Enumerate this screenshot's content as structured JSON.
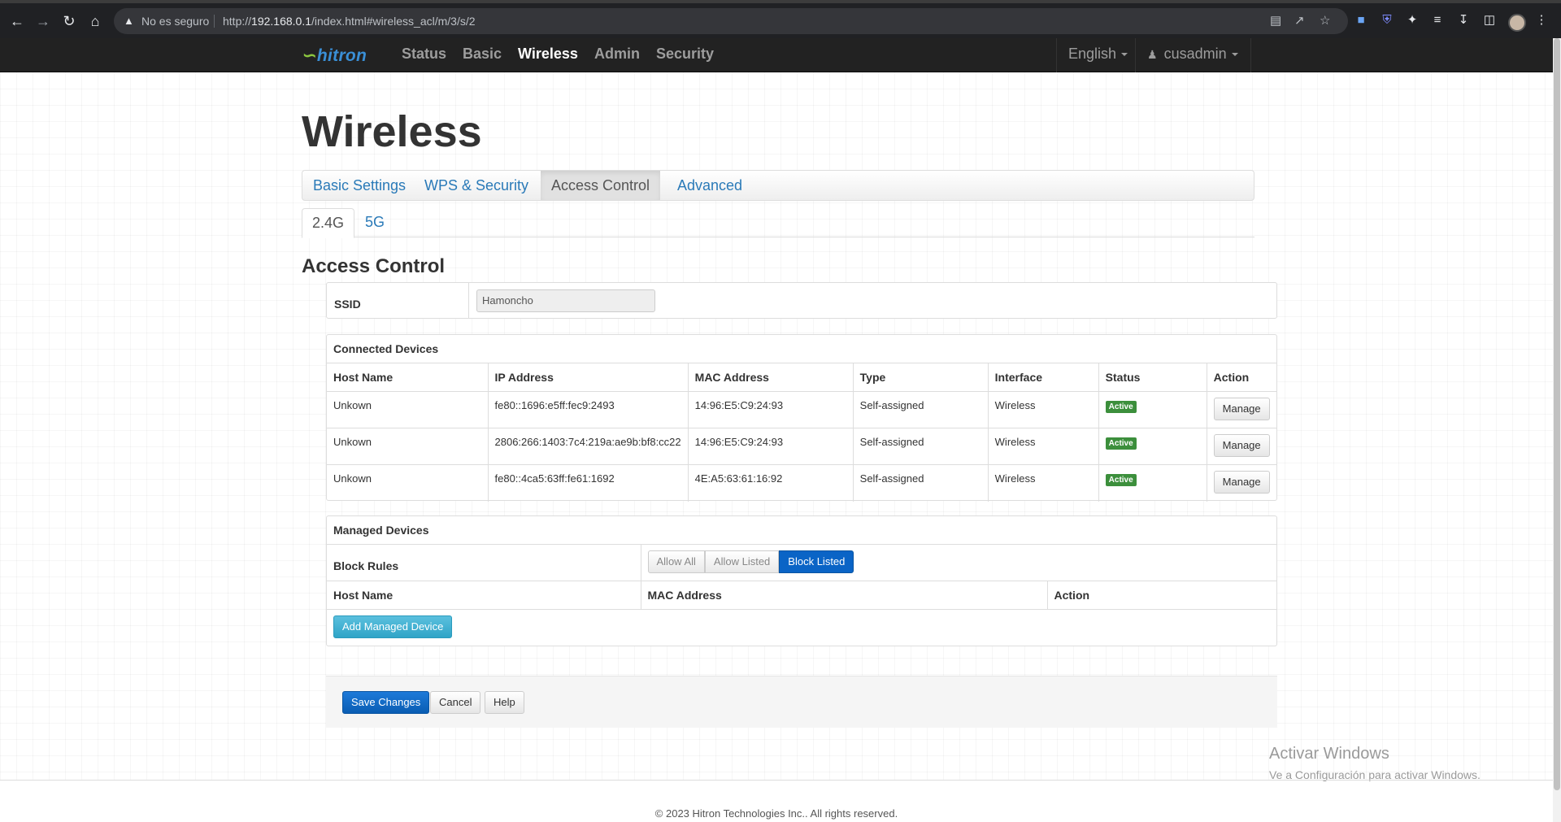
{
  "browser": {
    "security_text": "No es seguro",
    "url_prefix": "http://",
    "url_host": "192.168.0.1",
    "url_path": "/index.html#wireless_acl/m/3/s/2",
    "icons": [
      "back-icon",
      "forward-icon",
      "reload-icon",
      "home-icon",
      "warning-icon",
      "translate-icon",
      "share-icon",
      "star-icon",
      "extension-icon",
      "shield-icon",
      "puzzle-icon",
      "queue-icon",
      "download-icon",
      "sidebar-icon",
      "avatar",
      "menu-icon"
    ]
  },
  "topnav": {
    "logo": "hitron",
    "items": [
      {
        "label": "Status"
      },
      {
        "label": "Basic"
      },
      {
        "label": "Wireless",
        "active": true
      },
      {
        "label": "Admin"
      },
      {
        "label": "Security"
      }
    ],
    "language": "English",
    "user": "cusadmin"
  },
  "page": {
    "title": "Wireless",
    "tabs": [
      {
        "label": "Basic Settings"
      },
      {
        "label": "WPS & Security"
      },
      {
        "label": "Access Control",
        "active": true
      },
      {
        "label": "Advanced"
      }
    ],
    "band_tabs": [
      {
        "label": "2.4G",
        "active": true
      },
      {
        "label": "5G"
      }
    ],
    "section_title": "Access Control"
  },
  "ssid": {
    "label": "SSID",
    "value": "Hamoncho"
  },
  "connected": {
    "title": "Connected Devices",
    "columns": [
      "Host Name",
      "IP Address",
      "MAC Address",
      "Type",
      "Interface",
      "Status",
      "Action"
    ],
    "rows": [
      {
        "host": "Unkown",
        "ip": "fe80::1696:e5ff:fec9:2493",
        "mac": "14:96:E5:C9:24:93",
        "type": "Self-assigned",
        "interface": "Wireless",
        "status": "Active",
        "action": "Manage"
      },
      {
        "host": "Unkown",
        "ip": "2806:266:1403:7c4:219a:ae9b:bf8:cc22",
        "mac": "14:96:E5:C9:24:93",
        "type": "Self-assigned",
        "interface": "Wireless",
        "status": "Active",
        "action": "Manage"
      },
      {
        "host": "Unkown",
        "ip": "fe80::4ca5:63ff:fe61:1692",
        "mac": "4E:A5:63:61:16:92",
        "type": "Self-assigned",
        "interface": "Wireless",
        "status": "Active",
        "action": "Manage"
      }
    ]
  },
  "managed": {
    "title": "Managed Devices",
    "block_rules_label": "Block Rules",
    "block_options": [
      {
        "label": "Allow All"
      },
      {
        "label": "Allow Listed"
      },
      {
        "label": "Block Listed",
        "selected": true
      }
    ],
    "columns": [
      "Host Name",
      "MAC Address",
      "Action"
    ],
    "add_button": "Add Managed Device"
  },
  "actions": {
    "save": "Save Changes",
    "cancel": "Cancel",
    "help": "Help"
  },
  "watermark": {
    "line1": "Activar Windows",
    "line2": "Ve a Configuración para activar Windows."
  },
  "footer": "© 2023 Hitron Technologies Inc.. All rights reserved.",
  "colors": {
    "nav_bg": "#222222",
    "link": "#2a7ab8",
    "primary": "#0a64c6",
    "status_active": "#3c8f3c",
    "info": "#5bc0de"
  }
}
